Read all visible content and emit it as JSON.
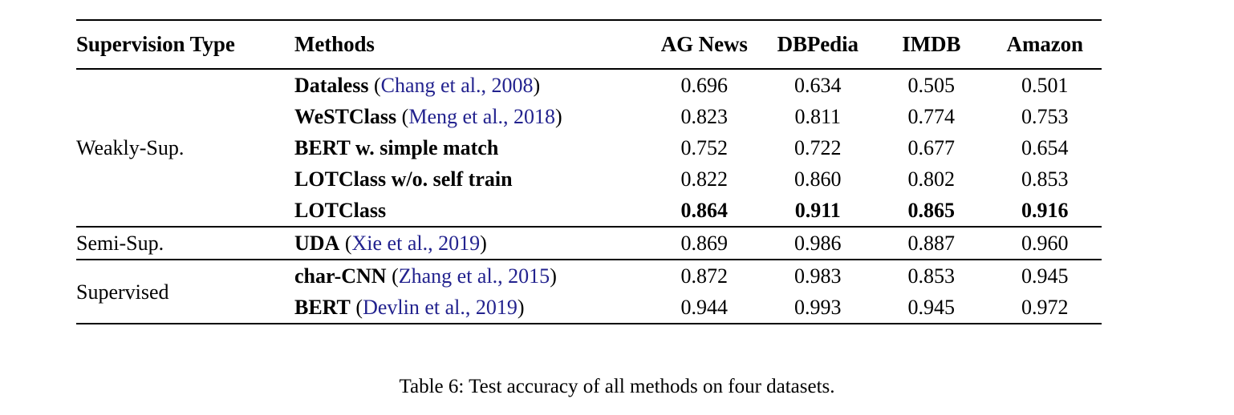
{
  "table": {
    "number_label": "Table 6",
    "caption": "Table 6: Test accuracy of all methods on four datasets.",
    "accent_citation_color": "#22228e",
    "columns": [
      {
        "key": "supervision",
        "header": "Supervision Type",
        "align": "left"
      },
      {
        "key": "methods",
        "header": "Methods",
        "align": "left"
      },
      {
        "key": "agnews",
        "header": "AG News",
        "align": "center"
      },
      {
        "key": "dbpedia",
        "header": "DBPedia",
        "align": "center"
      },
      {
        "key": "imdb",
        "header": "IMDB",
        "align": "center"
      },
      {
        "key": "amazon",
        "header": "Amazon",
        "align": "center"
      }
    ],
    "sections": [
      {
        "supervision": "Weakly-Sup.",
        "rows": [
          {
            "method_name": "Dataless",
            "citation": "Chang et al., 2008",
            "agnews": "0.696",
            "dbpedia": "0.634",
            "imdb": "0.505",
            "amazon": "0.501",
            "bold_values": false
          },
          {
            "method_name": "WeSTClass",
            "citation": "Meng et al., 2018",
            "agnews": "0.823",
            "dbpedia": "0.811",
            "imdb": "0.774",
            "amazon": "0.753",
            "bold_values": false
          },
          {
            "method_name": "BERT w. simple match",
            "citation": "",
            "agnews": "0.752",
            "dbpedia": "0.722",
            "imdb": "0.677",
            "amazon": "0.654",
            "bold_values": false
          },
          {
            "method_name": "LOTClass w/o. self train",
            "citation": "",
            "agnews": "0.822",
            "dbpedia": "0.860",
            "imdb": "0.802",
            "amazon": "0.853",
            "bold_values": false
          },
          {
            "method_name": "LOTClass",
            "citation": "",
            "agnews": "0.864",
            "dbpedia": "0.911",
            "imdb": "0.865",
            "amazon": "0.916",
            "bold_values": true
          }
        ]
      },
      {
        "supervision": "Semi-Sup.",
        "rows": [
          {
            "method_name": "UDA",
            "citation": "Xie et al., 2019",
            "agnews": "0.869",
            "dbpedia": "0.986",
            "imdb": "0.887",
            "amazon": "0.960",
            "bold_values": false
          }
        ]
      },
      {
        "supervision": "Supervised",
        "rows": [
          {
            "method_name": "char-CNN",
            "citation": "Zhang et al., 2015",
            "agnews": "0.872",
            "dbpedia": "0.983",
            "imdb": "0.853",
            "amazon": "0.945",
            "bold_values": false
          },
          {
            "method_name": "BERT",
            "citation": "Devlin et al., 2019",
            "agnews": "0.944",
            "dbpedia": "0.993",
            "imdb": "0.945",
            "amazon": "0.972",
            "bold_values": false
          }
        ]
      }
    ]
  }
}
